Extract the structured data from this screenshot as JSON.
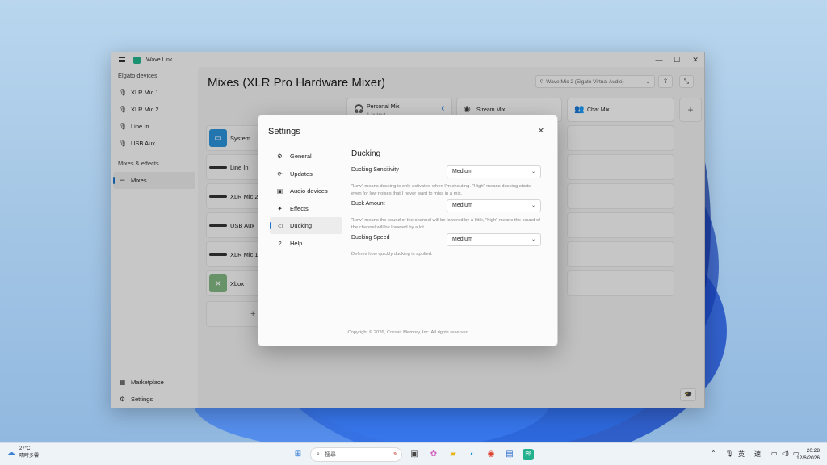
{
  "app": {
    "title": "Wave Link",
    "window_controls": {
      "minimize": "—",
      "maximize": "☐",
      "close": "✕"
    }
  },
  "sidebar": {
    "devices_header": "Elgato devices",
    "devices": [
      {
        "label": "XLR Mic 1",
        "icon": "mic-icon"
      },
      {
        "label": "XLR Mic 2",
        "icon": "mic-icon"
      },
      {
        "label": "Line In",
        "icon": "mic-icon"
      },
      {
        "label": "USB Aux",
        "icon": "mic-icon"
      }
    ],
    "effects_header": "Mixes & effects",
    "mixes_label": "Mixes",
    "marketplace_label": "Marketplace",
    "settings_label": "Settings"
  },
  "main": {
    "title": "Mixes (XLR Pro Hardware Mixer)",
    "monitor_device": "Wave Mic 2 (Elgato Virtual Audio)",
    "mixes": [
      {
        "label": "Personal Mix",
        "sub": "1 output"
      },
      {
        "label": "Stream Mix",
        "sub": ""
      },
      {
        "label": "Chat Mix",
        "sub": ""
      }
    ],
    "add_mix": "+",
    "channels": [
      "System",
      "Line In",
      "XLR Mic 2",
      "USB Aux",
      "XLR Mic 1",
      "Xbox"
    ],
    "add_channel": "+"
  },
  "settings_modal": {
    "title": "Settings",
    "close": "✕",
    "nav": [
      {
        "label": "General",
        "icon": "gear-icon"
      },
      {
        "label": "Updates",
        "icon": "refresh-icon"
      },
      {
        "label": "Audio devices",
        "icon": "speaker-icon"
      },
      {
        "label": "Effects",
        "icon": "effects-icon"
      },
      {
        "label": "Ducking",
        "icon": "volume-down-icon",
        "active": true
      },
      {
        "label": "Help",
        "icon": "help-icon"
      }
    ],
    "panel_title": "Ducking",
    "settings": [
      {
        "label": "Ducking Sensitivity",
        "value": "Medium",
        "desc": "\"Low\" means ducking is only activated when I'm shouting. \"High\" means ducking starts even for low noises that I never want to miss in a mix."
      },
      {
        "label": "Duck Amount",
        "value": "Medium",
        "desc": "\"Low\" means the sound of the channel will be lowered by a little, \"high\" means the sound of the channel will be lowered by a lot."
      },
      {
        "label": "Ducking Speed",
        "value": "Medium",
        "desc": "Defines how quickly ducking is applied."
      }
    ],
    "copyright": "Copyright © 2026, Corsair Memory, Inc. All rights reserved."
  },
  "taskbar": {
    "temperature": "27°C",
    "weather_text": "晴時多雲",
    "search_placeholder": "搜尋",
    "ime_lang": "英",
    "ime_mode": "速",
    "time": "20:28",
    "date": "12/6/2026"
  },
  "colors": {
    "accent": "#1a73c9",
    "system_icon": "#2b8fd6",
    "xbox_icon": "#7fb37f",
    "wave_link_logo": "#22b18c"
  }
}
